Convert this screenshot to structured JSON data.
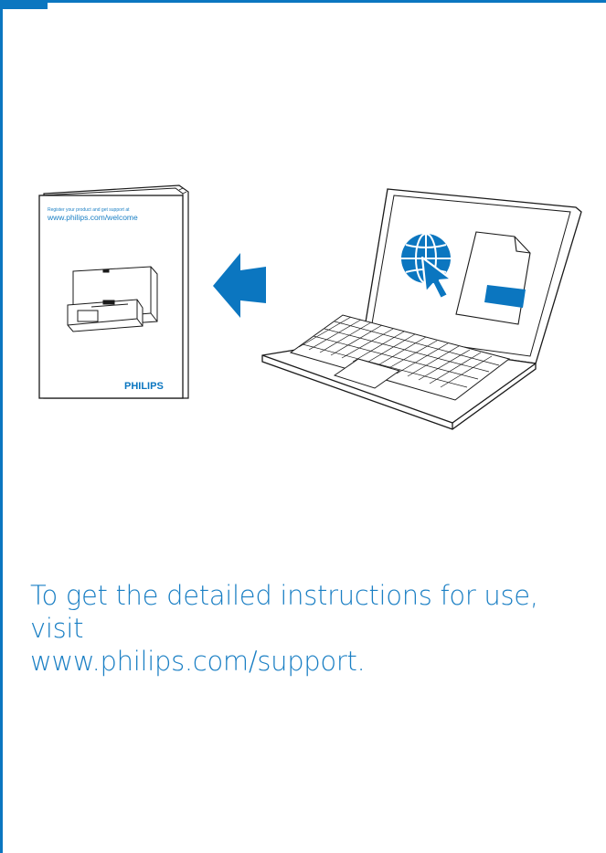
{
  "booklet": {
    "register_text": "Register your product and get support at",
    "url": "www.philips.com/welcome",
    "brand": "PHILIPS"
  },
  "instructions": {
    "line1": "To get the detailed instructions for use, visit",
    "line2": "www.philips.com/support."
  },
  "colors": {
    "accent": "#0b76c0",
    "text_blue": "#1a7fc4",
    "line": "#1a1a1a"
  },
  "icons": [
    "globe-icon",
    "cursor-icon",
    "document-icon",
    "arrow-left-icon"
  ]
}
